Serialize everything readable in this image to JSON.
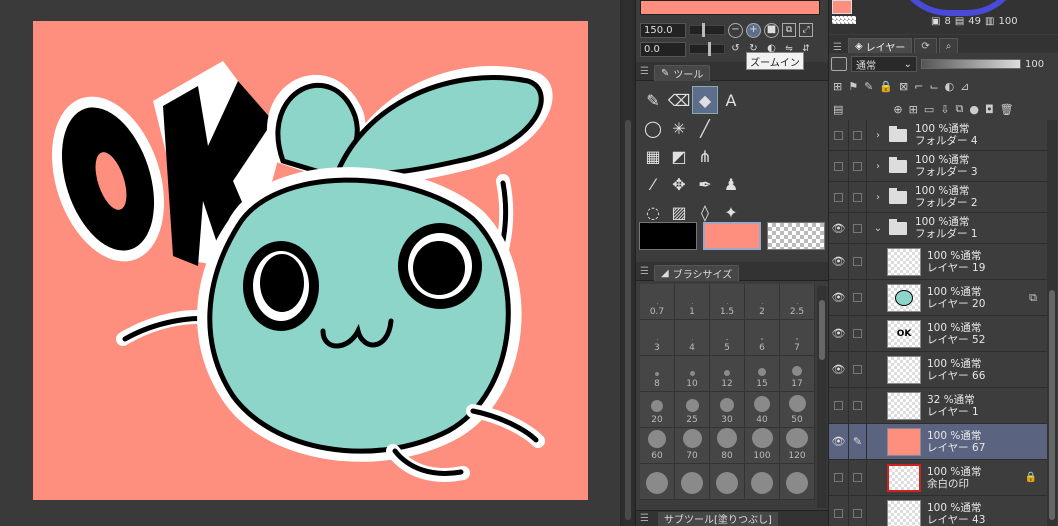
{
  "navigator": {
    "zoom_value": "150.0",
    "rotate_value": "0.0",
    "tooltip": "ズームイン"
  },
  "tool_panel": {
    "tab_label": "ツール",
    "tools": [
      {
        "name": "pen-icon",
        "glyph": "✎"
      },
      {
        "name": "eraser-icon",
        "glyph": "⌫"
      },
      {
        "name": "fill-icon",
        "glyph": "◆"
      },
      {
        "name": "text-icon",
        "glyph": "A"
      },
      {
        "name": "lasso-icon",
        "glyph": "◯"
      },
      {
        "name": "magic-wand-icon",
        "glyph": "✳"
      },
      {
        "name": "line-icon",
        "glyph": "╱"
      },
      {
        "name": "blank-1",
        "glyph": ""
      },
      {
        "name": "pattern-icon",
        "glyph": "▦"
      },
      {
        "name": "frame-icon",
        "glyph": "◩"
      },
      {
        "name": "grass-icon",
        "glyph": "⋔"
      },
      {
        "name": "blank-2",
        "glyph": ""
      },
      {
        "name": "eyedropper-icon",
        "glyph": "⁄"
      },
      {
        "name": "move-icon",
        "glyph": "✥"
      },
      {
        "name": "vector-pen-icon",
        "glyph": "✒"
      },
      {
        "name": "blend-icon",
        "glyph": "♟"
      },
      {
        "name": "balloon-icon",
        "glyph": "◌"
      },
      {
        "name": "gradient-icon",
        "glyph": "▨"
      },
      {
        "name": "drops-icon",
        "glyph": "◊"
      },
      {
        "name": "sparkle-icon",
        "glyph": "✦"
      }
    ],
    "colors": {
      "main": "#000000",
      "sub": "#fe8f7e"
    }
  },
  "brush_panel": {
    "tab_label": "ブラシサイズ",
    "sizes": [
      "0.7",
      "1",
      "1.5",
      "2",
      "2.5",
      "3",
      "4",
      "5",
      "6",
      "7",
      "8",
      "10",
      "12",
      "15",
      "17",
      "20",
      "25",
      "30",
      "40",
      "50",
      "60",
      "70",
      "80",
      "100",
      "120",
      "",
      "",
      "",
      "",
      ""
    ]
  },
  "subtool": {
    "tab_label": "サブツール[塗りつぶし]"
  },
  "color_readout": {
    "a": "8",
    "b": "49",
    "c": "100"
  },
  "layer_panel": {
    "tab_label": "レイヤー",
    "blend_mode": "通常",
    "opacity": "100",
    "layers": [
      {
        "type": "folder",
        "opacity": "100 %通常",
        "name": "フォルダー 4",
        "eye": false,
        "open": false
      },
      {
        "type": "folder",
        "opacity": "100 %通常",
        "name": "フォルダー 3",
        "eye": false,
        "open": false
      },
      {
        "type": "folder",
        "opacity": "100 %通常",
        "name": "フォルダー 2",
        "eye": false,
        "open": false
      },
      {
        "type": "folder",
        "opacity": "100 %通常",
        "name": "フォルダー 1",
        "eye": true,
        "open": true
      },
      {
        "type": "layer",
        "opacity": "100 %通常",
        "name": "レイヤー 19",
        "eye": true,
        "thumb": "lines"
      },
      {
        "type": "layer",
        "opacity": "100 %通常",
        "name": "レイヤー 20",
        "eye": true,
        "thumb": "teal",
        "mark": true
      },
      {
        "type": "layer",
        "opacity": "100 %通常",
        "name": "レイヤー 52",
        "eye": true,
        "thumb": "ok"
      },
      {
        "type": "layer",
        "opacity": "100 %通常",
        "name": "レイヤー 66",
        "eye": true,
        "thumb": "white"
      },
      {
        "type": "layer",
        "opacity": "32 %通常",
        "name": "レイヤー 1",
        "eye": false,
        "thumb": "sketch"
      },
      {
        "type": "layer",
        "opacity": "100 %通常",
        "name": "レイヤー 67",
        "eye": true,
        "thumb": "salmon",
        "selected": true,
        "pen": true
      },
      {
        "type": "layer",
        "opacity": "100 %通常",
        "name": "余白の印",
        "eye": false,
        "thumb": "redframe",
        "lock": true
      },
      {
        "type": "layer",
        "opacity": "100 %通常",
        "name": "レイヤー 43",
        "eye": false,
        "thumb": "sketch2"
      }
    ]
  },
  "canvas": {
    "bg_color": "#fe8f7e",
    "character_color": "#8dd4c9",
    "ok_text": "OK"
  }
}
